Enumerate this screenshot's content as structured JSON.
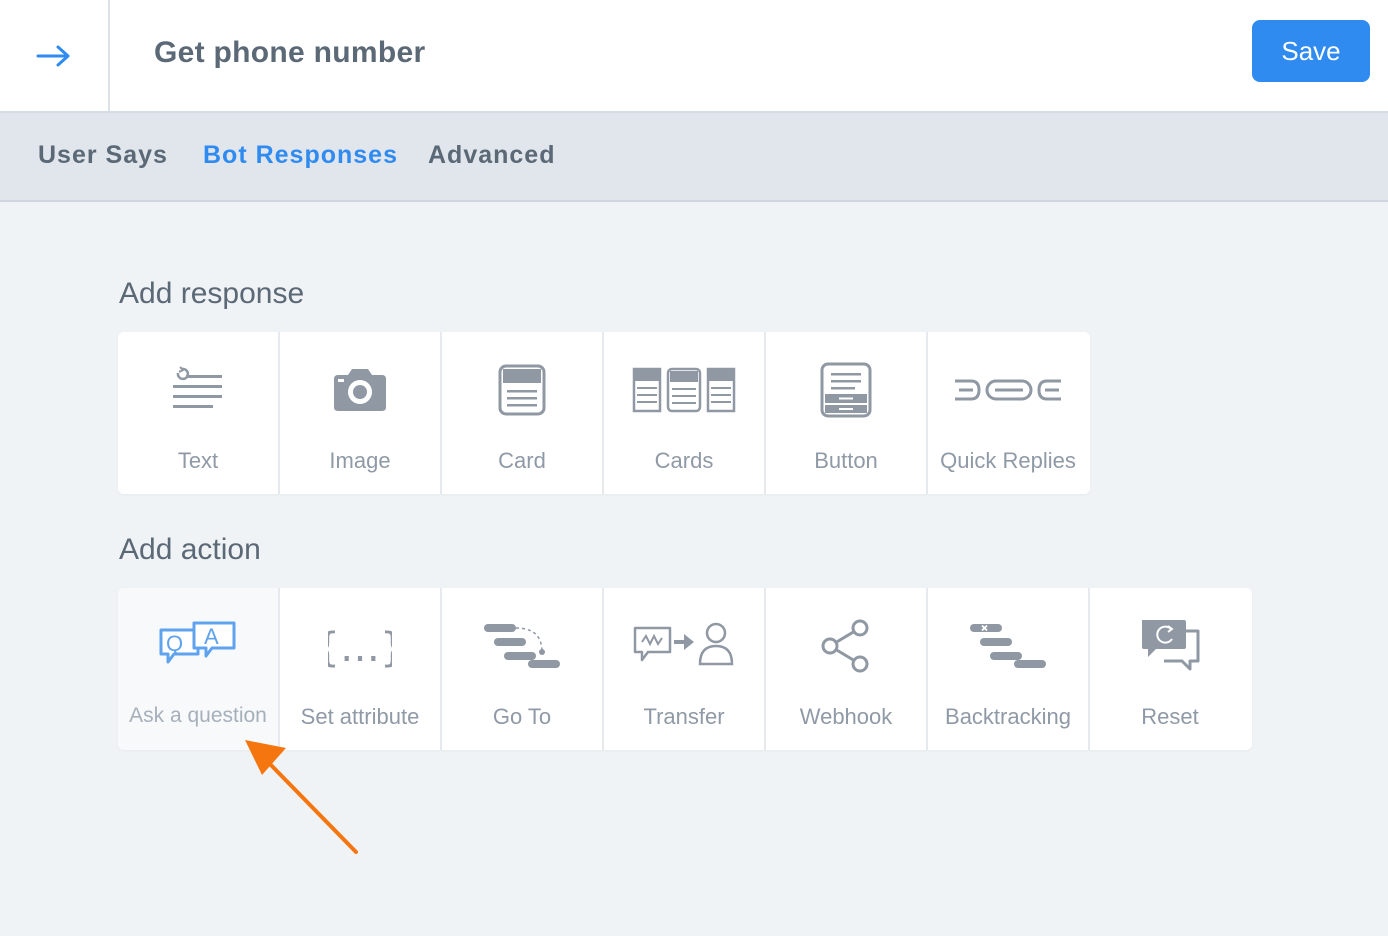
{
  "header": {
    "back_icon": "arrow-right-icon",
    "title": "Get phone number",
    "save_label": "Save",
    "accent_color": "#2f8bf0"
  },
  "tabs": [
    {
      "label": "User Says",
      "active": false
    },
    {
      "label": "Bot Responses",
      "active": true
    },
    {
      "label": "Advanced",
      "active": false
    }
  ],
  "responses": {
    "title": "Add response",
    "items": [
      {
        "label": "Text",
        "icon": "text-lines-icon"
      },
      {
        "label": "Image",
        "icon": "camera-icon"
      },
      {
        "label": "Card",
        "icon": "card-icon"
      },
      {
        "label": "Cards",
        "icon": "cards-icon"
      },
      {
        "label": "Button",
        "icon": "button-icon"
      },
      {
        "label": "Quick Replies",
        "icon": "quick-replies-icon"
      }
    ]
  },
  "actions": {
    "title": "Add action",
    "items": [
      {
        "label": "Ask a question",
        "icon": "qa-icon"
      },
      {
        "label": "Set attribute",
        "icon": "curly-braces-icon"
      },
      {
        "label": "Go To",
        "icon": "goto-flow-icon"
      },
      {
        "label": "Transfer",
        "icon": "transfer-icon"
      },
      {
        "label": "Webhook",
        "icon": "share-nodes-icon"
      },
      {
        "label": "Backtracking",
        "icon": "backtracking-icon"
      },
      {
        "label": "Reset",
        "icon": "reset-chat-icon"
      }
    ]
  },
  "annotation": {
    "icon": "pointer-arrow-icon",
    "color": "#f5760f"
  }
}
